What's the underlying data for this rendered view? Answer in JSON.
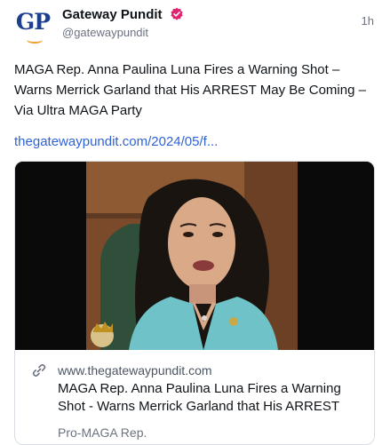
{
  "post": {
    "avatar_text": "GP",
    "author_name": "Gateway Pundit",
    "handle": "@gatewaypundit",
    "time": "1h",
    "text": "MAGA Rep. Anna Paulina Luna Fires a Warning Shot – Warns Merrick Garland that His ARREST May Be Coming – Via Ultra MAGA Party",
    "link": "thegatewaypundit.com/2024/05/f..."
  },
  "card": {
    "domain": "www.thegatewaypundit.com",
    "title": "MAGA Rep. Anna Paulina Luna Fires a Warning Shot - Warns Merrick Garland that His ARREST",
    "description": "Pro-MAGA Rep."
  },
  "icons": {
    "verified": "verified-badge-icon",
    "link": "link-icon"
  },
  "colors": {
    "link": "#2e63d6",
    "verified": "#e0246f",
    "avatar_text": "#1d3f8f"
  }
}
